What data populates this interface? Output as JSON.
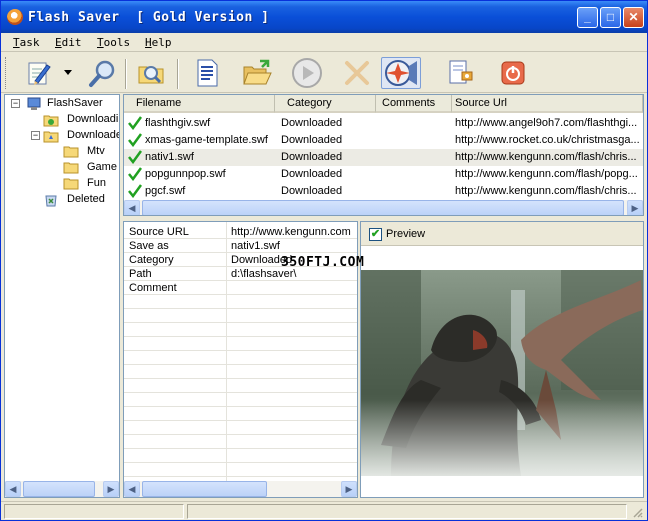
{
  "window": {
    "title": "Flash Saver  [ Gold Version ]"
  },
  "menu": [
    {
      "u": "T",
      "rest": "ask"
    },
    {
      "u": "E",
      "rest": "dit"
    },
    {
      "u": "T",
      "rest": "ools"
    },
    {
      "u": "H",
      "rest": "elp"
    }
  ],
  "toolbar": {
    "icons": [
      "edit-icon",
      "dropdown-arrow-icon",
      "search-icon",
      "find-folder-icon",
      "document-icon",
      "open-folder-icon",
      "play-icon",
      "delete-icon",
      "capture-icon",
      "settings-icon",
      "exit-icon"
    ]
  },
  "tree": {
    "root": "FlashSaver",
    "downloading": "Downloadi",
    "downloaded": "Downloade",
    "folders": [
      "Mtv",
      "Game",
      "Fun"
    ],
    "deleted": "Deleted"
  },
  "files": {
    "columns": [
      "Filename",
      "Category",
      "Comments",
      "Source Url"
    ],
    "rows": [
      {
        "name": "flashthgiv.swf",
        "category": "Downloaded",
        "comments": "",
        "url": "http://www.angel9oh7.com/flashthgi..."
      },
      {
        "name": "xmas-game-template.swf",
        "category": "Downloaded",
        "comments": "",
        "url": "http://www.rocket.co.uk/christmasga..."
      },
      {
        "name": "nativ1.swf",
        "category": "Downloaded",
        "comments": "",
        "url": "http://www.kengunn.com/flash/chris..."
      },
      {
        "name": "popgunnpop.swf",
        "category": "Downloaded",
        "comments": "",
        "url": "http://www.kengunn.com/flash/popg..."
      },
      {
        "name": "pgcf.swf",
        "category": "Downloaded",
        "comments": "",
        "url": "http://www.kengunn.com/flash/chris..."
      }
    ],
    "selected_index": 2
  },
  "properties": [
    {
      "key": "Source URL",
      "value": "http://www.kengunn.com"
    },
    {
      "key": "Save as",
      "value": "nativ1.swf"
    },
    {
      "key": "Category",
      "value": "Downloaded"
    },
    {
      "key": "Path",
      "value": "d:\\flashsaver\\"
    },
    {
      "key": "Comment",
      "value": ""
    }
  ],
  "preview": {
    "label": "Preview",
    "checked": true
  },
  "watermark": "350FTJ.COM"
}
